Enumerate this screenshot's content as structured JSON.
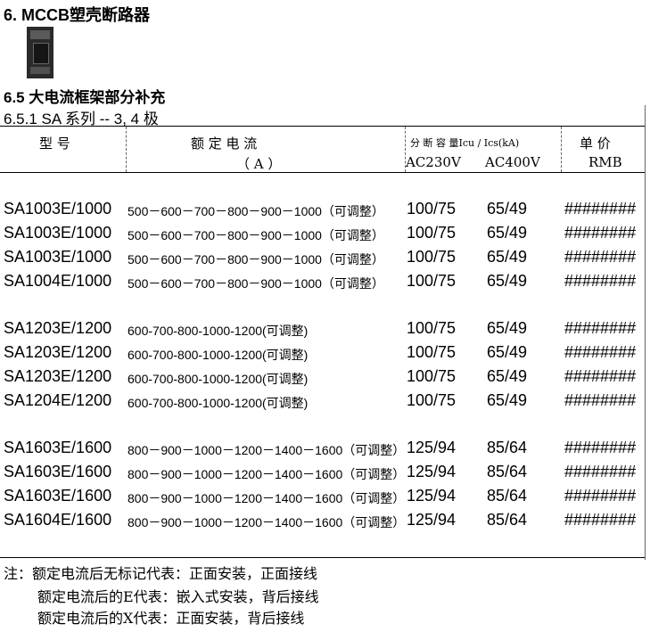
{
  "title": "6.  MCCB塑壳断路器",
  "section": "6.5 大电流框架部分补充",
  "subsection": "6.5.1  SA 系列 --  3, 4 极",
  "table": {
    "headers": {
      "model": "型    号",
      "current_title": "额    定    电    流",
      "current_unit": "（ A ）",
      "breaking_title": "分 断 容 量Icu / Ics(kA)",
      "ac230": "AC230V",
      "ac400": "AC400V",
      "price_title": "单    价",
      "price_unit": "RMB"
    },
    "groups": [
      [
        {
          "model": "SA1003E/1000",
          "current": "500－600－700－800－900－1000（可调整）",
          "ac230": "100/75",
          "ac400": "65/49",
          "price": "########"
        },
        {
          "model": "SA1003E/1000",
          "current": "500－600－700－800－900－1000（可调整）",
          "ac230": "100/75",
          "ac400": "65/49",
          "price": "########"
        },
        {
          "model": "SA1003E/1000",
          "current": "500－600－700－800－900－1000（可调整）",
          "ac230": "100/75",
          "ac400": "65/49",
          "price": "########"
        },
        {
          "model": "SA1004E/1000",
          "current": "500－600－700－800－900－1000（可调整）",
          "ac230": "100/75",
          "ac400": "65/49",
          "price": "########"
        }
      ],
      [
        {
          "model": "SA1203E/1200",
          "current": "600-700-800-1000-1200(可调整)",
          "ac230": "100/75",
          "ac400": "65/49",
          "price": "########"
        },
        {
          "model": "SA1203E/1200",
          "current": "600-700-800-1000-1200(可调整)",
          "ac230": "100/75",
          "ac400": "65/49",
          "price": "########"
        },
        {
          "model": "SA1203E/1200",
          "current": "600-700-800-1000-1200(可调整)",
          "ac230": "100/75",
          "ac400": "65/49",
          "price": "########"
        },
        {
          "model": "SA1204E/1200",
          "current": "600-700-800-1000-1200(可调整)",
          "ac230": "100/75",
          "ac400": "65/49",
          "price": "########"
        }
      ],
      [
        {
          "model": "SA1603E/1600",
          "current": "800－900－1000－1200－1400－1600（可调整）",
          "ac230": "125/94",
          "ac400": "85/64",
          "price": "########"
        },
        {
          "model": "SA1603E/1600",
          "current": "800－900－1000－1200－1400－1600（可调整）",
          "ac230": "125/94",
          "ac400": "85/64",
          "price": "########"
        },
        {
          "model": "SA1603E/1600",
          "current": "800－900－1000－1200－1400－1600（可调整）",
          "ac230": "125/94",
          "ac400": "85/64",
          "price": "########"
        },
        {
          "model": "SA1604E/1600",
          "current": "800－900－1000－1200－1400－1600（可调整）",
          "ac230": "125/94",
          "ac400": "85/64",
          "price": "########"
        }
      ]
    ]
  },
  "notes": [
    "注：额定电流后无标记代表：正面安装，正面接线",
    "额定电流后的E代表：嵌入式安装，背后接线",
    "额定电流后的X代表：正面安装，背后接线"
  ]
}
